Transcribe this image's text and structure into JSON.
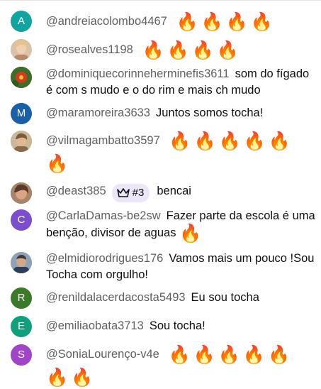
{
  "messages": [
    {
      "avatar_letter": "A",
      "avatar_color": "#12a4a0",
      "author": "@andreiacolombo4467",
      "text": "",
      "emoji_count": 4,
      "icon": "fire-emoji"
    },
    {
      "avatar_letter": "",
      "avatar_color": "#c9a37c",
      "author": "@rosealves1198",
      "text": "",
      "emoji_count": 4,
      "icon": "fire-emoji"
    },
    {
      "avatar_letter": "",
      "avatar_color": "#b5342a",
      "author": "@dominiquecorinneherminefis3611",
      "text": "som do fígado é com s mudo e o do rim e mais ch mudo",
      "emoji_count": 0
    },
    {
      "avatar_letter": "M",
      "avatar_color": "#1a5fa8",
      "author": "@maramoreira3633",
      "text": "Juntos somos tocha!",
      "emoji_count": 0
    },
    {
      "avatar_letter": "",
      "avatar_color": "#a58d6c",
      "author": "@vilmagambatto3597",
      "text": "",
      "emoji_count": 6,
      "icon": "fire-emoji"
    },
    {
      "avatar_letter": "",
      "avatar_color": "#8a5a3c",
      "author": "@deast385",
      "text": "bencai",
      "emoji_count": 0,
      "badge": {
        "label": "#3",
        "icon": "crown-icon",
        "color": "#ede6fb"
      }
    },
    {
      "avatar_letter": "C",
      "avatar_color": "#7c4dcc",
      "author": "@CarlaDamas-be2sw",
      "text": "Fazer parte da escola é uma benção, divisor de aguas",
      "emoji_count": 1,
      "icon": "fire-emoji"
    },
    {
      "avatar_letter": "",
      "avatar_color": "#6b7f95",
      "author": "@elmidiorodrigues176",
      "text": "Vamos mais um pouco !Sou Tocha com orgulho!",
      "emoji_count": 0
    },
    {
      "avatar_letter": "R",
      "avatar_color": "#3a7a28",
      "author": "@renildalacerdacosta5493",
      "text": "Eu sou tocha",
      "emoji_count": 0
    },
    {
      "avatar_letter": "E",
      "avatar_color": "#12a07c",
      "author": "@emiliaobata3713",
      "text": "Sou tocha!",
      "emoji_count": 0
    },
    {
      "avatar_letter": "S",
      "avatar_color": "#a045c8",
      "author": "@SoniaLourenço-v4e",
      "text": "",
      "emoji_count": 7,
      "icon": "fire-emoji"
    }
  ],
  "emoji_char": "🔥"
}
